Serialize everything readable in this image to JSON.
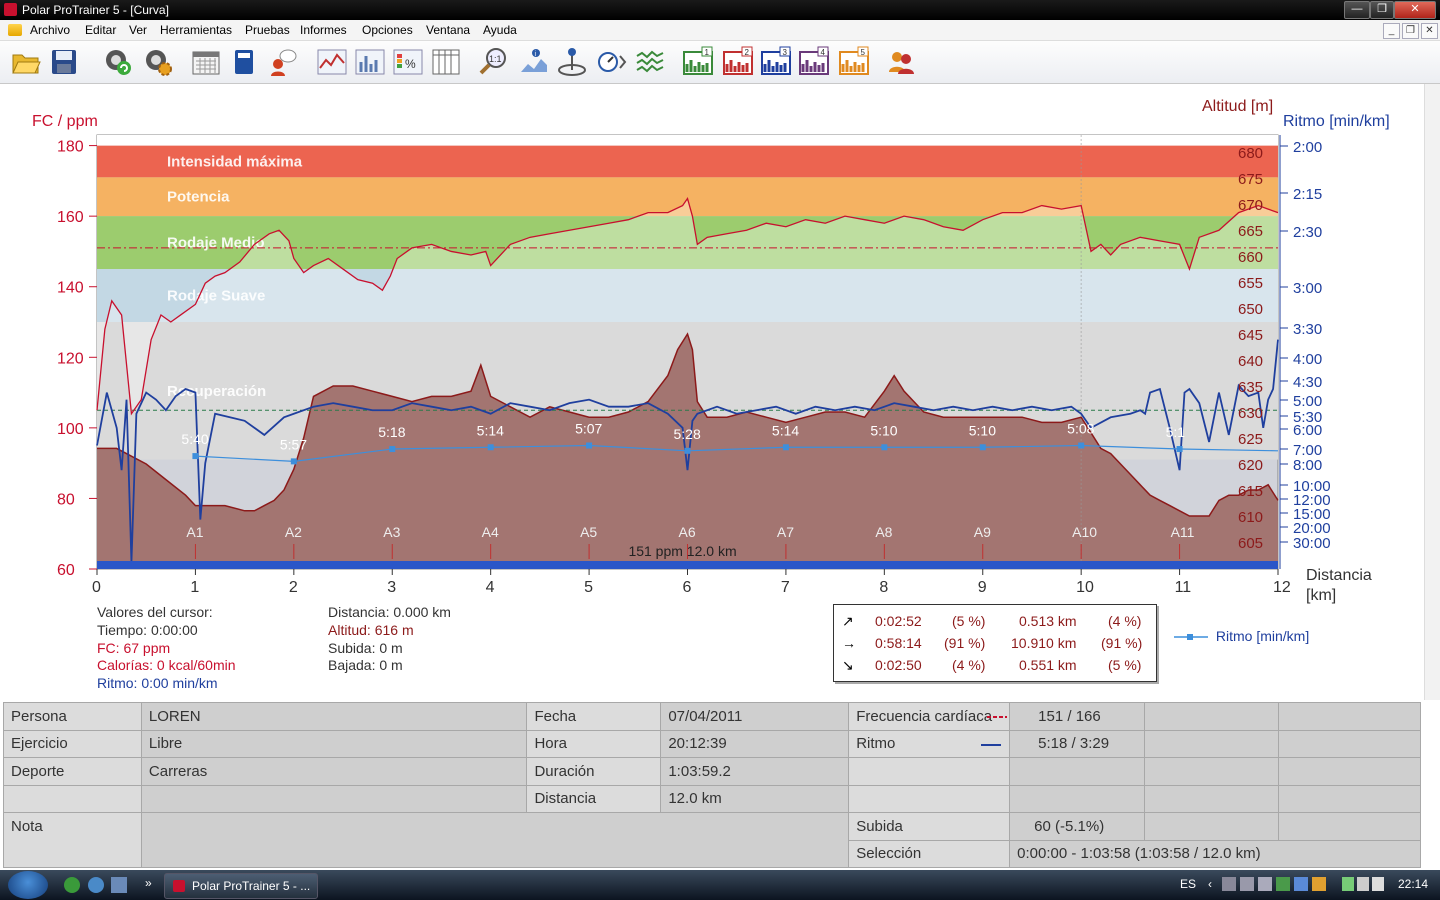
{
  "window": {
    "title": "Polar ProTrainer 5 - [Curva]",
    "controls": {
      "minimize": "—",
      "restore": "❐",
      "close": "✕"
    },
    "mdi_controls": {
      "minimize": "_",
      "restore": "❐",
      "close": "✕"
    }
  },
  "menu": [
    "Archivo",
    "Editar",
    "Ver",
    "Herramientas",
    "Pruebas",
    "Informes",
    "Opciones",
    "Ventana",
    "Ayuda"
  ],
  "toolbar": {
    "icons": [
      "open-folder-icon",
      "save-icon",
      "sync-icon",
      "settings-gear-icon",
      "calendar-icon",
      "diary-book-icon",
      "user-tip-icon",
      "curve-icon",
      "bar-chart-icon",
      "percent-chart-icon",
      "table-icon",
      "zoom-icon",
      "info-chart-icon",
      "info-marker-icon",
      "speed-icon",
      "compare-icon",
      "chart-1-icon",
      "chart-2-icon",
      "chart-3-icon",
      "chart-4-icon",
      "chart-5-icon",
      "users-icon"
    ],
    "numbered": [
      "1",
      "2",
      "3",
      "4",
      "5"
    ],
    "zoom_label": "1:1"
  },
  "colors": {
    "hr_red": "#c8102e",
    "pace_blue": "#1f3f9e",
    "pace_light_blue": "#3d8fdc",
    "altitude_fill": "#a0706c",
    "altitude_line": "#8c1a1a",
    "zone_max": "#ec6450",
    "zone_power": "#f5b262",
    "zone_medium": "#9ccc6e",
    "zone_easy": "#c3d8e4",
    "zone_recovery": "#dadada",
    "zone_below": "#d1d3da"
  },
  "chart_data": {
    "type": "line",
    "left_axis_label": "FC / ppm",
    "right_axis_label_1": "Altitud [m]",
    "right_axis_label_2": "Ritmo [min/km]",
    "x_axis_label_1": "Distancia",
    "x_axis_label_2": "[km]",
    "x_ticks": [
      0,
      1,
      2,
      3,
      4,
      5,
      6,
      7,
      8,
      9,
      10,
      11,
      12
    ],
    "xlim": [
      0,
      12
    ],
    "hr_ticks": [
      60,
      80,
      100,
      120,
      140,
      160,
      180
    ],
    "hr_ylim": [
      60,
      183
    ],
    "altitude_ticks": [
      605,
      610,
      615,
      620,
      625,
      630,
      635,
      640,
      645,
      650,
      655,
      660,
      665,
      670,
      675,
      680
    ],
    "altitude_tick_labels": [
      "605",
      "610",
      "615",
      "620",
      "625",
      "630",
      "635",
      "640",
      "645",
      "650",
      "655",
      "660",
      "665",
      "670",
      "675",
      "680"
    ],
    "pace_ticks": [
      "2:00",
      "2:15",
      "2:30",
      "3:00",
      "3:30",
      "4:00",
      "4:30",
      "5:00",
      "5:30",
      "6:00",
      "7:00",
      "8:00",
      "10:00",
      "12:00",
      "15:00",
      "20:00",
      "30:00"
    ],
    "zones": [
      {
        "name": "Intensidad máxima",
        "from": 171,
        "to": 180
      },
      {
        "name": "Potencia",
        "from": 160,
        "to": 171
      },
      {
        "name": "Rodaje Medio",
        "from": 145,
        "to": 160
      },
      {
        "name": "Rodaje Suave",
        "from": 130,
        "to": 145
      },
      {
        "name": "Recuperación",
        "from": 91,
        "to": 130
      }
    ],
    "avg_hr": 151,
    "avg_pace_ref": 105,
    "laps": [
      "A1",
      "A2",
      "A3",
      "A4",
      "A5",
      "A6",
      "A7",
      "A8",
      "A9",
      "A10",
      "A11"
    ],
    "lap_km": [
      1,
      2,
      3,
      4,
      5,
      6,
      7,
      8,
      9,
      10,
      11
    ],
    "lap_pace": [
      "5:40",
      "5:57",
      "5:18",
      "5:14",
      "5:07",
      "5:28",
      "5:14",
      "5:10",
      "5:10",
      "5:08",
      "5:1"
    ],
    "lap_pace_hr": [
      92,
      90.5,
      94,
      94.5,
      95,
      93.5,
      94.5,
      94.5,
      94.5,
      95,
      94
    ],
    "summary_label": "151 ppm 12.0 km",
    "hr_series": {
      "name": "FC",
      "x": [
        0,
        0.08,
        0.15,
        0.25,
        0.35,
        0.45,
        0.55,
        0.65,
        0.75,
        0.85,
        1.0,
        1.1,
        1.2,
        1.3,
        1.45,
        1.6,
        1.75,
        1.85,
        1.95,
        2.0,
        2.1,
        2.2,
        2.35,
        2.5,
        2.65,
        2.8,
        2.9,
        2.98,
        3.05,
        3.2,
        3.4,
        3.6,
        3.8,
        3.95,
        4.0,
        4.2,
        4.4,
        4.6,
        4.8,
        5.0,
        5.2,
        5.4,
        5.6,
        5.8,
        5.95,
        6.0,
        6.05,
        6.1,
        6.2,
        6.4,
        6.6,
        6.8,
        7.0,
        7.2,
        7.4,
        7.6,
        7.8,
        8.0,
        8.2,
        8.4,
        8.6,
        8.8,
        9.0,
        9.2,
        9.4,
        9.6,
        9.8,
        10.0,
        10.1,
        10.2,
        10.3,
        10.4,
        10.6,
        10.8,
        11.0,
        11.1,
        11.2,
        11.4,
        11.6,
        11.8,
        11.9,
        12.0
      ],
      "values": [
        105,
        128,
        136,
        132,
        104,
        108,
        125,
        132,
        130,
        132,
        135,
        141,
        143,
        144,
        147,
        152,
        155,
        156,
        153,
        148,
        144,
        146,
        148,
        145,
        142,
        141,
        139,
        143,
        148,
        151,
        152,
        150,
        149,
        150,
        146,
        152,
        154,
        155,
        156,
        157,
        158,
        159,
        161,
        161,
        163,
        165,
        160,
        152,
        154,
        155,
        156,
        158,
        157,
        159,
        158,
        160,
        159,
        158,
        160,
        159,
        157,
        156,
        159,
        161,
        161,
        163,
        162,
        163,
        150,
        152,
        149,
        152,
        154,
        153,
        152,
        145,
        154,
        156,
        161,
        163,
        162,
        161
      ]
    },
    "pace_series": {
      "name": "Ritmo",
      "x": [
        0,
        0.1,
        0.2,
        0.25,
        0.3,
        0.35,
        0.4,
        0.5,
        0.6,
        0.7,
        0.8,
        0.9,
        1.0,
        1.05,
        1.1,
        1.2,
        1.35,
        1.5,
        1.7,
        1.9,
        2.0,
        2.2,
        2.4,
        2.6,
        2.8,
        3.0,
        3.2,
        3.4,
        3.6,
        3.8,
        4.0,
        4.2,
        4.4,
        4.6,
        4.8,
        5.0,
        5.2,
        5.4,
        5.6,
        5.8,
        5.95,
        6.0,
        6.05,
        6.1,
        6.3,
        6.5,
        6.7,
        6.9,
        7.1,
        7.3,
        7.5,
        7.7,
        7.9,
        8.1,
        8.3,
        8.5,
        8.7,
        8.9,
        9.1,
        9.3,
        9.5,
        9.7,
        9.9,
        10.0,
        10.1,
        10.3,
        10.5,
        10.6,
        10.65,
        10.7,
        10.8,
        10.9,
        11.0,
        11.05,
        11.1,
        11.2,
        11.3,
        11.4,
        11.5,
        11.6,
        11.7,
        11.8,
        11.85,
        11.9,
        11.95,
        12.0
      ],
      "values": [
        95,
        110,
        100,
        88,
        108,
        62,
        104,
        110,
        108,
        105,
        109,
        111,
        110,
        74,
        90,
        104,
        103,
        102,
        98,
        103,
        104,
        106,
        107,
        106,
        105,
        105,
        107,
        106,
        105,
        106,
        104,
        107,
        106,
        105,
        107,
        108,
        106,
        106,
        107,
        104,
        100,
        88,
        102,
        104,
        106,
        104,
        105,
        106,
        104,
        106,
        105,
        106,
        105,
        107,
        106,
        105,
        106,
        105,
        106,
        105,
        106,
        105,
        106,
        104,
        100,
        103,
        104,
        105,
        104,
        110,
        111,
        100,
        88,
        110,
        111,
        107,
        96,
        110,
        98,
        112,
        109,
        110,
        100,
        108,
        111,
        125
      ]
    },
    "altitude_series": {
      "name": "Altitud",
      "x": [
        0,
        0.2,
        0.5,
        0.7,
        0.9,
        1.0,
        1.1,
        1.3,
        1.5,
        1.6,
        1.7,
        1.8,
        1.9,
        2.0,
        2.1,
        2.2,
        2.4,
        2.6,
        2.8,
        3.0,
        3.2,
        3.4,
        3.6,
        3.8,
        3.9,
        4.0,
        4.2,
        4.4,
        4.6,
        4.8,
        5.0,
        5.2,
        5.4,
        5.6,
        5.8,
        5.9,
        6.0,
        6.05,
        6.1,
        6.2,
        6.4,
        6.6,
        6.8,
        7.0,
        7.2,
        7.4,
        7.6,
        7.8,
        8.0,
        8.1,
        8.2,
        8.4,
        8.6,
        8.8,
        9.0,
        9.2,
        9.4,
        9.6,
        9.8,
        10.0,
        10.1,
        10.2,
        10.3,
        10.4,
        10.5,
        10.6,
        10.7,
        10.8,
        10.9,
        11.0,
        11.1,
        11.2,
        11.3,
        11.4,
        11.5,
        11.6,
        11.7,
        11.8,
        11.9,
        12.0
      ],
      "values": [
        623,
        623,
        620,
        617,
        614,
        612,
        612,
        612,
        611,
        611,
        612,
        613,
        615,
        619,
        625,
        633,
        635,
        635,
        634,
        633,
        632,
        633,
        633,
        634,
        639,
        633,
        631,
        629,
        631,
        630,
        629,
        629,
        630,
        632,
        637,
        642,
        645,
        642,
        632,
        629,
        629,
        630,
        629,
        628,
        629,
        630,
        630,
        629,
        634,
        637,
        634,
        630,
        629,
        629,
        629,
        629,
        629,
        628,
        628,
        629,
        626,
        623,
        622,
        620,
        618,
        616,
        614,
        613,
        612,
        611,
        610,
        610,
        610,
        613,
        614,
        614,
        615,
        615,
        616,
        613
      ]
    }
  },
  "cursor_values": {
    "heading": "Valores del cursor:",
    "tiempo": "Tiempo: 0:00:00",
    "fc": "FC: 67 ppm",
    "calorias": "Calorías: 0 kcal/60min",
    "ritmo": "Ritmo: 0:00 min/km",
    "distancia": "Distancia: 0.000 km",
    "altitud": "Altitud: 616 m",
    "subida": "Subida: 0 m",
    "bajada": "Bajada: 0 m"
  },
  "slope_stats": [
    {
      "dir": "↗",
      "time": "0:02:52",
      "time_pct": "(5 %)",
      "dist": "0.513 km",
      "dist_pct": "(4 %)"
    },
    {
      "dir": "→",
      "time": "0:58:14",
      "time_pct": "(91 %)",
      "dist": "10.910 km",
      "dist_pct": "(91 %)"
    },
    {
      "dir": "↘",
      "time": "0:02:50",
      "time_pct": "(4 %)",
      "dist": "0.551 km",
      "dist_pct": "(5 %)"
    }
  ],
  "legend": {
    "pace": "Ritmo [min/km]"
  },
  "info_table": {
    "rows": [
      [
        "Persona",
        "LOREN",
        "Fecha",
        "07/04/2011",
        "Frecuencia cardíaca",
        "151 / 166",
        "",
        ""
      ],
      [
        "Ejercicio",
        "Libre",
        "Hora",
        "20:12:39",
        "Ritmo",
        "5:18 / 3:29",
        "",
        ""
      ],
      [
        "Deporte",
        "Carreras",
        "Duración",
        "1:03:59.2",
        "",
        "",
        "",
        ""
      ],
      [
        "",
        "",
        "Distancia",
        "12.0 km",
        "",
        "",
        "",
        ""
      ],
      [
        "Nota",
        "",
        "",
        "",
        "Subida",
        "60 (-5.1%)",
        "",
        ""
      ],
      [
        "",
        "",
        "",
        "",
        "Selección",
        "0:00:00 - 1:03:58 (1:03:58 / 12.0 km)",
        "",
        ""
      ]
    ]
  },
  "taskbar": {
    "app_button": "Polar ProTrainer 5 - ...",
    "quicklaunch_more": "»",
    "language": "ES",
    "clock": "22:14"
  }
}
